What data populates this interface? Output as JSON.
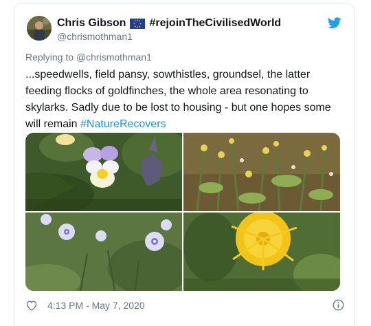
{
  "tweet": {
    "author_name": "Chris Gibson",
    "author_tagline": "#rejoinTheCivilisedWorld",
    "handle": "@chrismothman1",
    "reply_prefix": "Replying to",
    "reply_to": "@chrismothman1",
    "text": "...speedwells, field pansy, sowthistles, groundsel, the latter feeding flocks of goldfinches, the whole area resonating to skylarks. Sadly due to be lost to housing - but one hopes some will remain",
    "hashtag": "#NatureRecovers",
    "timestamp": "4:13 PM - May 7, 2020"
  },
  "colors": {
    "link": "#1b95e0",
    "twitter_blue": "#1da1f2",
    "secondary_text": "#657786",
    "border": "#e1e8ed"
  },
  "icons": {
    "brand": "twitter-bird-icon",
    "flag": "eu-flag-icon",
    "like": "heart-icon",
    "info": "info-icon"
  }
}
